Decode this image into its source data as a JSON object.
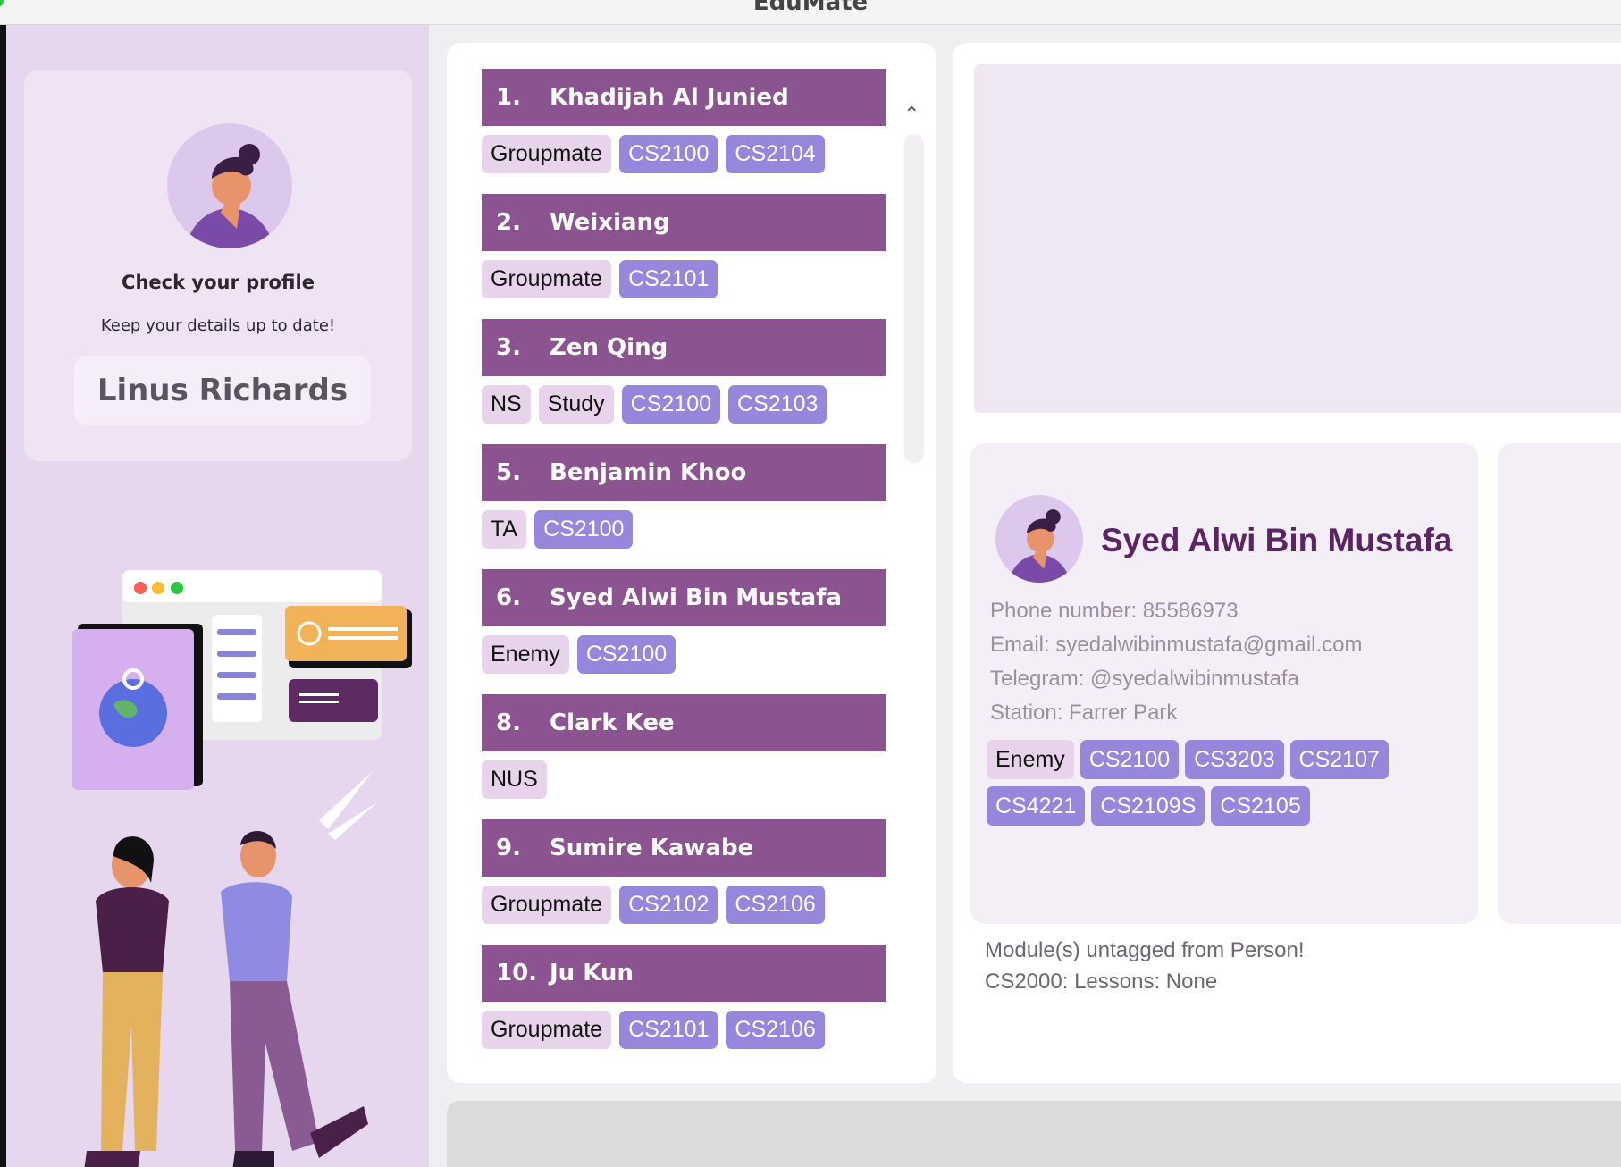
{
  "window": {
    "title": "EduMate"
  },
  "profile": {
    "heading": "Check your profile",
    "subtitle": "Keep your details up to date!",
    "name": "Linus Richards"
  },
  "persons": [
    {
      "index": "1.",
      "name": "Khadijah Al Junied",
      "tags": [
        {
          "label": "Groupmate",
          "kind": "gen"
        },
        {
          "label": "CS2100",
          "kind": "mod"
        },
        {
          "label": "CS2104",
          "kind": "mod"
        }
      ]
    },
    {
      "index": "2.",
      "name": "Weixiang",
      "tags": [
        {
          "label": "Groupmate",
          "kind": "gen"
        },
        {
          "label": "CS2101",
          "kind": "mod"
        }
      ]
    },
    {
      "index": "3.",
      "name": "Zen Qing",
      "tags": [
        {
          "label": "NS",
          "kind": "gen"
        },
        {
          "label": "Study",
          "kind": "gen"
        },
        {
          "label": "CS2100",
          "kind": "mod"
        },
        {
          "label": "CS2103",
          "kind": "mod"
        }
      ]
    },
    {
      "index": "5.",
      "name": "Benjamin Khoo",
      "tags": [
        {
          "label": "TA",
          "kind": "gen"
        },
        {
          "label": "CS2100",
          "kind": "mod"
        }
      ]
    },
    {
      "index": "6.",
      "name": "Syed Alwi Bin Mustafa",
      "tags": [
        {
          "label": "Enemy",
          "kind": "gen"
        },
        {
          "label": "CS2100",
          "kind": "mod"
        }
      ]
    },
    {
      "index": "8.",
      "name": "Clark Kee",
      "tags": [
        {
          "label": "NUS",
          "kind": "gen"
        }
      ]
    },
    {
      "index": "9.",
      "name": "Sumire Kawabe",
      "tags": [
        {
          "label": "Groupmate",
          "kind": "gen"
        },
        {
          "label": "CS2102",
          "kind": "mod"
        },
        {
          "label": "CS2106",
          "kind": "mod"
        }
      ]
    },
    {
      "index": "10.",
      "name": "Ju Kun",
      "tags": [
        {
          "label": "Groupmate",
          "kind": "gen"
        },
        {
          "label": "CS2101",
          "kind": "mod"
        },
        {
          "label": "CS2106",
          "kind": "mod"
        }
      ]
    }
  ],
  "detail": {
    "name": "Syed Alwi Bin Mustafa",
    "phone": "Phone number: 85586973",
    "email": "Email: syedalwibinmustafa@gmail.com",
    "telegram": "Telegram: @syedalwibinmustafa",
    "station": "Station: Farrer Park",
    "tags": [
      {
        "label": "Enemy",
        "kind": "gen"
      },
      {
        "label": "CS2100",
        "kind": "mod"
      },
      {
        "label": "CS3203",
        "kind": "mod"
      },
      {
        "label": "CS2107",
        "kind": "mod"
      },
      {
        "label": "CS4221",
        "kind": "mod"
      },
      {
        "label": "CS2109S",
        "kind": "mod"
      },
      {
        "label": "CS2105",
        "kind": "mod"
      }
    ]
  },
  "result": {
    "line1": "Module(s) untagged from Person!",
    "line2": "CS2000: Lessons: None"
  },
  "colors": {
    "accent": "#8b5390",
    "module_tag": "#9686dc",
    "general_tag": "#e7d3ea",
    "sidebar": "#e6d7ee"
  }
}
